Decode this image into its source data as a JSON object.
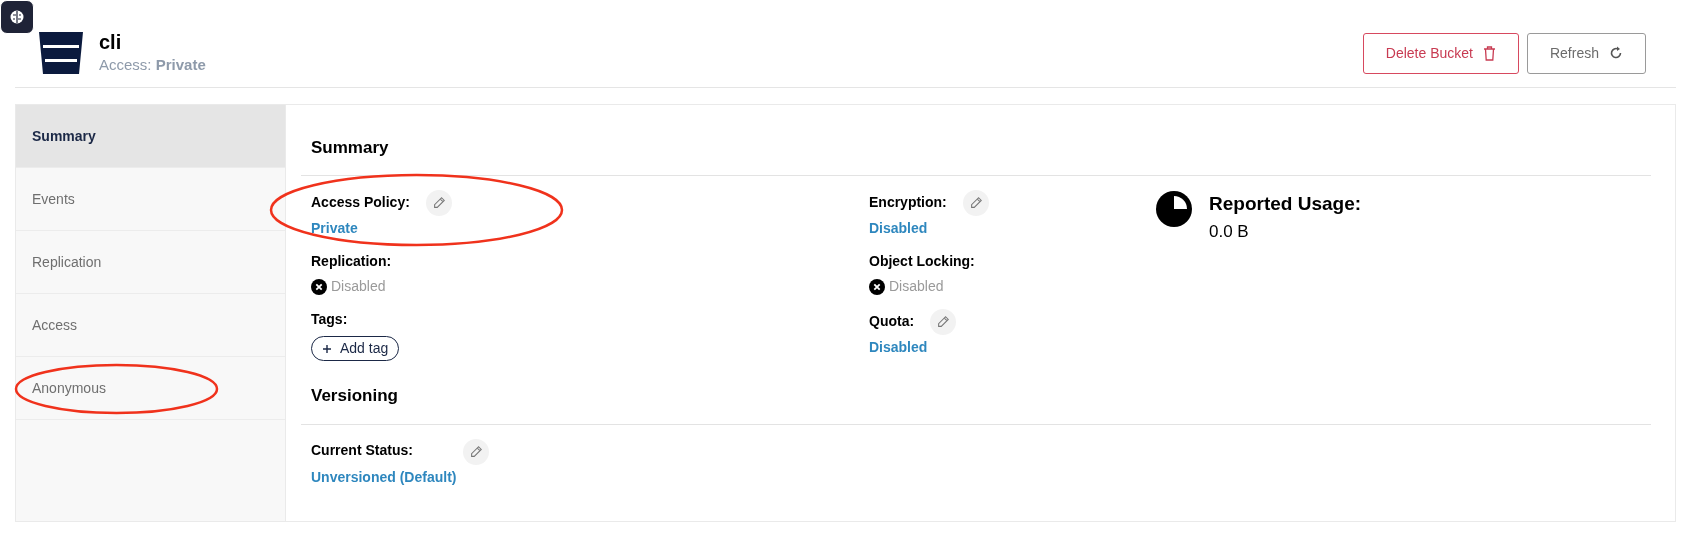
{
  "header": {
    "title": "cli",
    "access_label": "Access:",
    "access_value": "Private"
  },
  "buttons": [
    {
      "label": "Delete Bucket",
      "kind": "danger"
    },
    {
      "label": "Refresh",
      "kind": "secondary"
    }
  ],
  "sidebar": {
    "items": [
      {
        "label": "Summary",
        "selected": true,
        "circled": false
      },
      {
        "label": "Events",
        "selected": false,
        "circled": false
      },
      {
        "label": "Replication",
        "selected": false,
        "circled": false
      },
      {
        "label": "Access",
        "selected": false,
        "circled": false
      },
      {
        "label": "Anonymous",
        "selected": false,
        "circled": true
      }
    ]
  },
  "summary": {
    "title": "Summary",
    "columns": [
      [
        {
          "kind": "link",
          "label": "Access Policy:",
          "value": "Private",
          "editable": true,
          "circled": true
        },
        {
          "kind": "status",
          "label": "Replication:",
          "value": "Disabled",
          "editable": false,
          "circled": false
        },
        {
          "kind": "tags",
          "label": "Tags:",
          "value": "Add tag",
          "editable": false,
          "circled": false
        }
      ],
      [
        {
          "kind": "link",
          "label": "Encryption:",
          "value": "Disabled",
          "editable": true,
          "circled": false
        },
        {
          "kind": "status",
          "label": "Object Locking:",
          "value": "Disabled",
          "editable": false,
          "circled": false
        },
        {
          "kind": "link",
          "label": "Quota:",
          "value": "Disabled",
          "editable": true,
          "circled": false
        }
      ]
    ],
    "usage": {
      "title": "Reported Usage:",
      "value": "0.0 B"
    }
  },
  "versioning": {
    "title": "Versioning",
    "fields": [
      {
        "kind": "link",
        "label": "Current Status:",
        "value": "Unversioned (Default)",
        "editable": true,
        "circled": false
      }
    ]
  }
}
